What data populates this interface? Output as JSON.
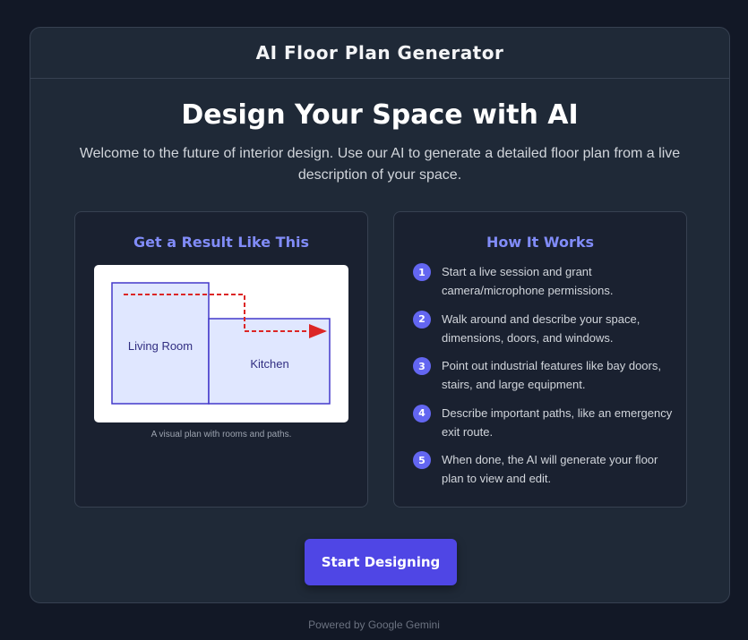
{
  "header": {
    "title": "AI Floor Plan Generator"
  },
  "hero": {
    "title": "Design Your Space with AI",
    "subtitle": "Welcome to the future of interior design. Use our AI to generate a detailed floor plan from a live description of your space."
  },
  "example_panel": {
    "title": "Get a Result Like This",
    "rooms": [
      "Living Room",
      "Kitchen"
    ],
    "caption": "A visual plan with rooms and paths."
  },
  "how_it_works": {
    "title": "How It Works",
    "steps": [
      {
        "number": "1",
        "text": "Start a live session and grant camera/microphone permissions."
      },
      {
        "number": "2",
        "text": "Walk around and describe your space, dimensions, doors, and windows."
      },
      {
        "number": "3",
        "text": "Point out industrial features like bay doors, stairs, and large equipment."
      },
      {
        "number": "4",
        "text": "Describe important paths, like an emergency exit route."
      },
      {
        "number": "5",
        "text": "When done, the AI will generate your floor plan to view and edit."
      }
    ]
  },
  "cta": {
    "label": "Start Designing"
  },
  "footer": {
    "text": "Powered by Google Gemini"
  },
  "colors": {
    "background": "#121826",
    "card": "#1f2937",
    "accent": "#6366f1",
    "button": "#4f46e5",
    "panel_title": "#818cf8",
    "room_fill": "#e0e7ff",
    "room_stroke": "#4338ca",
    "path": "#dc2626"
  }
}
